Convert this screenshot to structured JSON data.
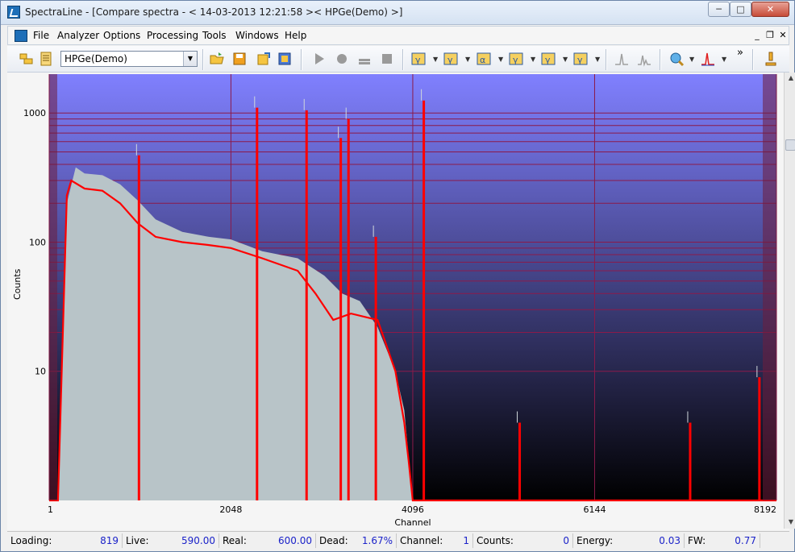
{
  "window": {
    "title": "SpectraLine - [Compare spectra - < 14-03-2013 12:21:58 >< HPGe(Demo) >]",
    "min_label": "─",
    "max_label": "□",
    "close_label": "✕"
  },
  "menu": {
    "items": [
      "File",
      "Analyzer",
      "Options",
      "Processing",
      "Tools",
      "Windows",
      "Help"
    ],
    "mdi_min": "_",
    "mdi_restore": "❐",
    "mdi_close": "✕"
  },
  "toolbar": {
    "analyzer_select": "HPGe(Demo)",
    "icons": [
      "open-folder-icon",
      "spectrum-list-icon",
      "open-file-icon",
      "save-icon",
      "export-icon",
      "report-icon",
      "play-icon",
      "record-icon",
      "stop-icon",
      "pause-icon",
      "gamma-filter-icon",
      "gamma-filter-icon",
      "alpha-filter-icon",
      "gamma-filter-icon",
      "gamma-filter-icon",
      "gamma-filter-icon",
      "peak-icon",
      "peak-compare-icon",
      "search-nuclide-icon",
      "spectrum-peak-icon",
      "microscope-icon"
    ],
    "overflow": "»"
  },
  "chart_data": {
    "type": "line",
    "title": "",
    "xlabel": "Channel",
    "ylabel": "Counts",
    "y_scale": "log",
    "xlim": [
      1,
      8192
    ],
    "ylim": [
      1,
      2000
    ],
    "x_ticks": [
      "1",
      "2048",
      "4096",
      "6144",
      "8192"
    ],
    "y_ticks": [
      "10",
      "100",
      "1000"
    ],
    "grid": true,
    "series": [
      {
        "color": "#b8c4c8",
        "style": "filled",
        "x": [
          1,
          100,
          200,
          300,
          400,
          600,
          800,
          1000,
          1200,
          1500,
          1800,
          2048,
          2400,
          2800,
          3100,
          3300,
          3500,
          3700,
          3900,
          4000,
          4096
        ],
        "y": [
          1,
          1,
          200,
          380,
          340,
          330,
          280,
          210,
          150,
          120,
          110,
          105,
          85,
          75,
          55,
          40,
          35,
          22,
          10,
          5,
          1
        ]
      },
      {
        "color": "#ff0000",
        "style": "line",
        "x": [
          1,
          100,
          200,
          250,
          400,
          600,
          800,
          1000,
          1200,
          1500,
          1800,
          2048,
          2400,
          2800,
          3000,
          3200,
          3400,
          3700,
          3900,
          4000,
          4050,
          4096,
          4300,
          5000,
          6000,
          7000,
          8000,
          8192
        ],
        "y": [
          1,
          1,
          230,
          300,
          260,
          250,
          200,
          140,
          110,
          100,
          95,
          90,
          75,
          60,
          40,
          25,
          28,
          25,
          10,
          4,
          2,
          1,
          1,
          1,
          1,
          1,
          1,
          1
        ]
      }
    ],
    "peaks": [
      {
        "x": 1012,
        "y": 470
      },
      {
        "x": 2342,
        "y": 1100
      },
      {
        "x": 2900,
        "y": 1050
      },
      {
        "x": 3285,
        "y": 640
      },
      {
        "x": 3372,
        "y": 900
      },
      {
        "x": 3680,
        "y": 110
      },
      {
        "x": 4220,
        "y": 1250
      },
      {
        "x": 5300,
        "y": 4
      },
      {
        "x": 7220,
        "y": 4
      },
      {
        "x": 8000,
        "y": 9
      }
    ],
    "grid_lines_counts": [
      1000,
      900,
      800,
      700,
      600,
      500,
      400,
      300,
      200,
      100,
      90,
      80,
      70,
      60,
      50,
      40,
      30,
      20,
      10
    ],
    "background": {
      "top": "#8080ff",
      "bottom": "#000000"
    }
  },
  "status": {
    "loading_label": "Loading:",
    "loading": "819",
    "live_label": "Live:",
    "live": "590.00",
    "real_label": "Real:",
    "real": "600.00",
    "dead_label": "Dead:",
    "dead": "1.67%",
    "channel_label": "Channel:",
    "channel": "1",
    "counts_label": "Counts:",
    "counts": "0",
    "energy_label": "Energy:",
    "energy": "0.03",
    "fw_label": "FW:",
    "fw": "0.77"
  }
}
